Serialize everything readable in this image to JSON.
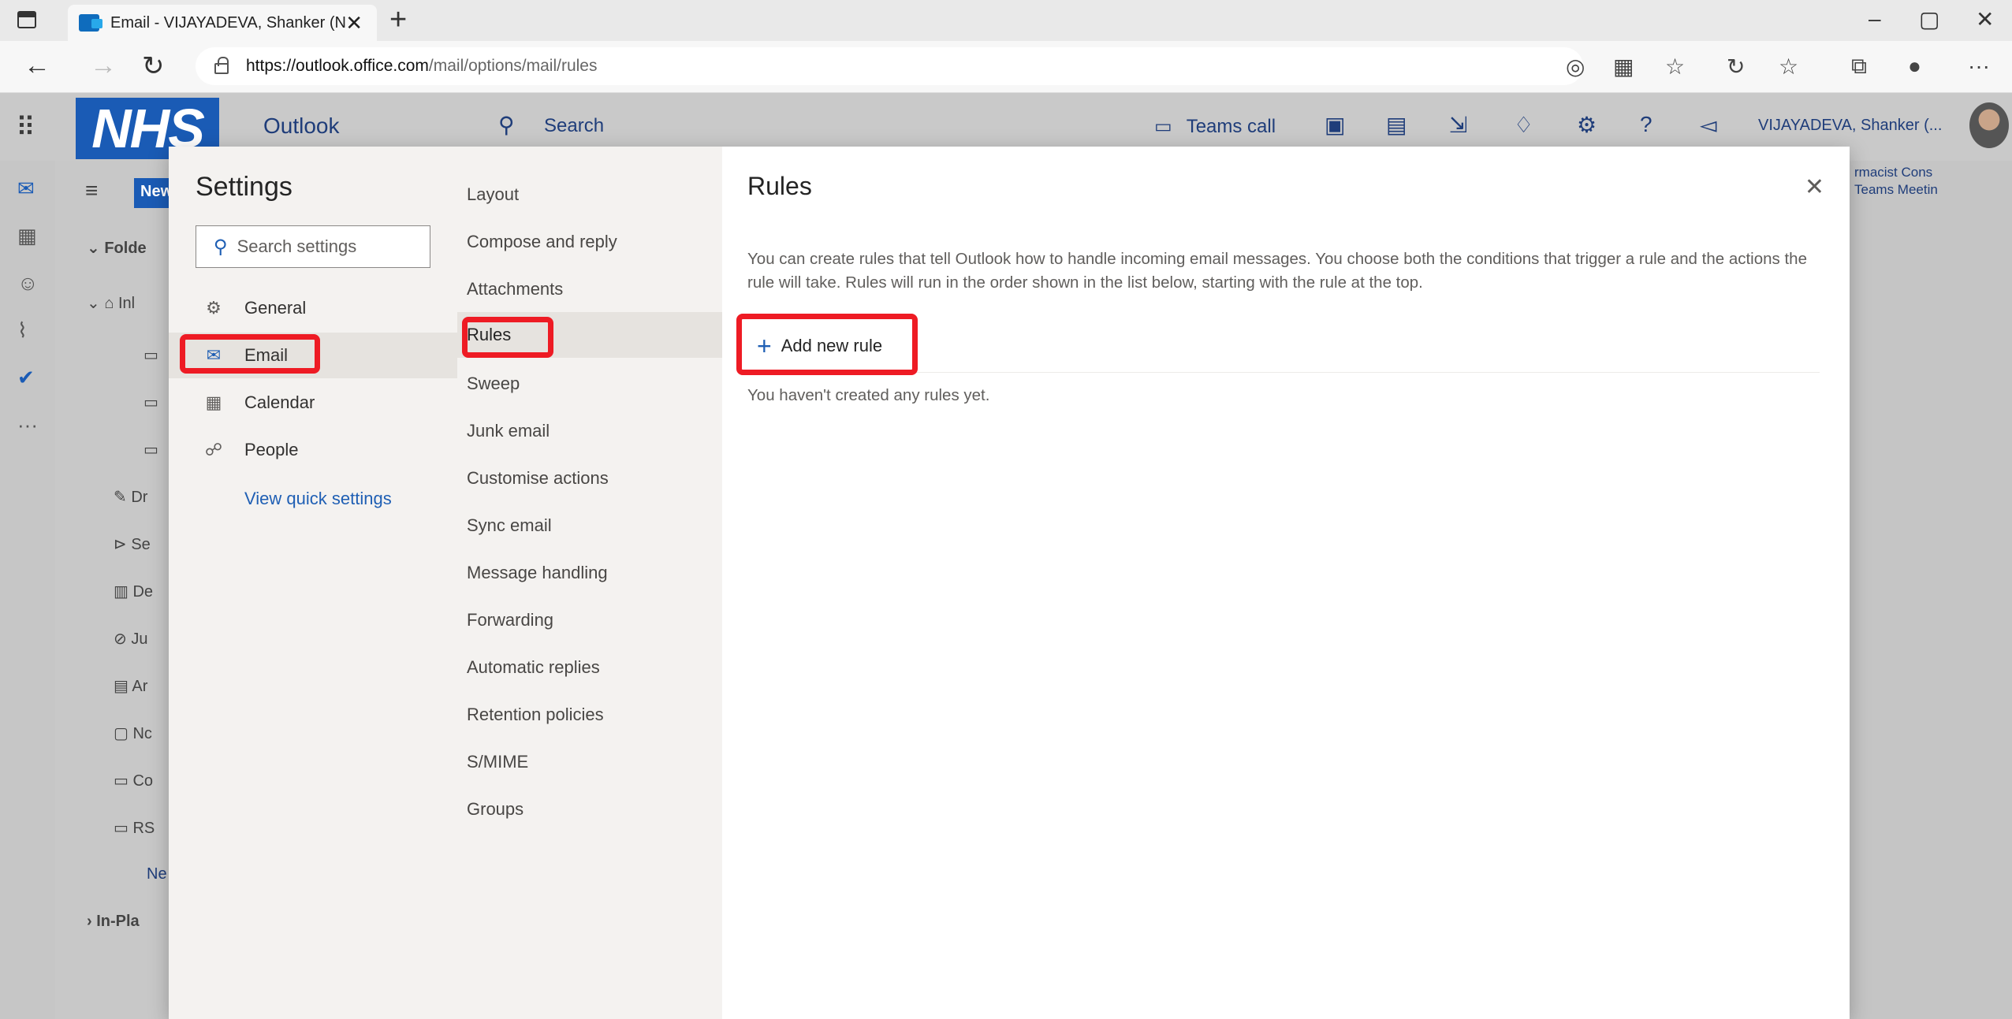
{
  "browser": {
    "tab_title": "Email - VIJAYADEVA, Shanker (N",
    "url_host": "https://outlook.office.com",
    "url_path": "/mail/options/mail/rules"
  },
  "header": {
    "logo_text": "NHS",
    "app_name": "Outlook",
    "search_label": "Search",
    "teams_call": "Teams call",
    "user_name": "VIJAYADEVA, Shanker (..."
  },
  "background": {
    "new_button": "New",
    "folders_label": "Folde",
    "in_place_label": "In-Pla",
    "reading_line1": "rmacist Cons",
    "reading_line2": "Teams Meetin",
    "folder_labels": [
      "Inl",
      "Dr",
      "Se",
      "De",
      "Ju",
      "Ar",
      "Nc",
      "Co",
      "RS",
      "Ne"
    ]
  },
  "settings": {
    "title": "Settings",
    "search_placeholder": "Search settings",
    "categories": [
      {
        "label": "General",
        "icon": "gear-icon"
      },
      {
        "label": "Email",
        "icon": "mail-icon"
      },
      {
        "label": "Calendar",
        "icon": "calendar-icon"
      },
      {
        "label": "People",
        "icon": "people-icon"
      }
    ],
    "quick_settings_link": "View quick settings",
    "email_subsections": [
      "Layout",
      "Compose and reply",
      "Attachments",
      "Rules",
      "Sweep",
      "Junk email",
      "Customise actions",
      "Sync email",
      "Message handling",
      "Forwarding",
      "Automatic replies",
      "Retention policies",
      "S/MIME",
      "Groups"
    ]
  },
  "rules": {
    "title": "Rules",
    "description": "You can create rules that tell Outlook how to handle incoming email messages. You choose both the conditions that trigger a rule and the actions the rule will take. Rules will run in the order shown in the list below, starting with the rule at the top.",
    "add_button": "Add new rule",
    "empty_message": "You haven't created any rules yet."
  },
  "colors": {
    "accent": "#1f5fb4",
    "highlight": "#ee1b24",
    "nhs_blue": "#1a5bb5"
  }
}
